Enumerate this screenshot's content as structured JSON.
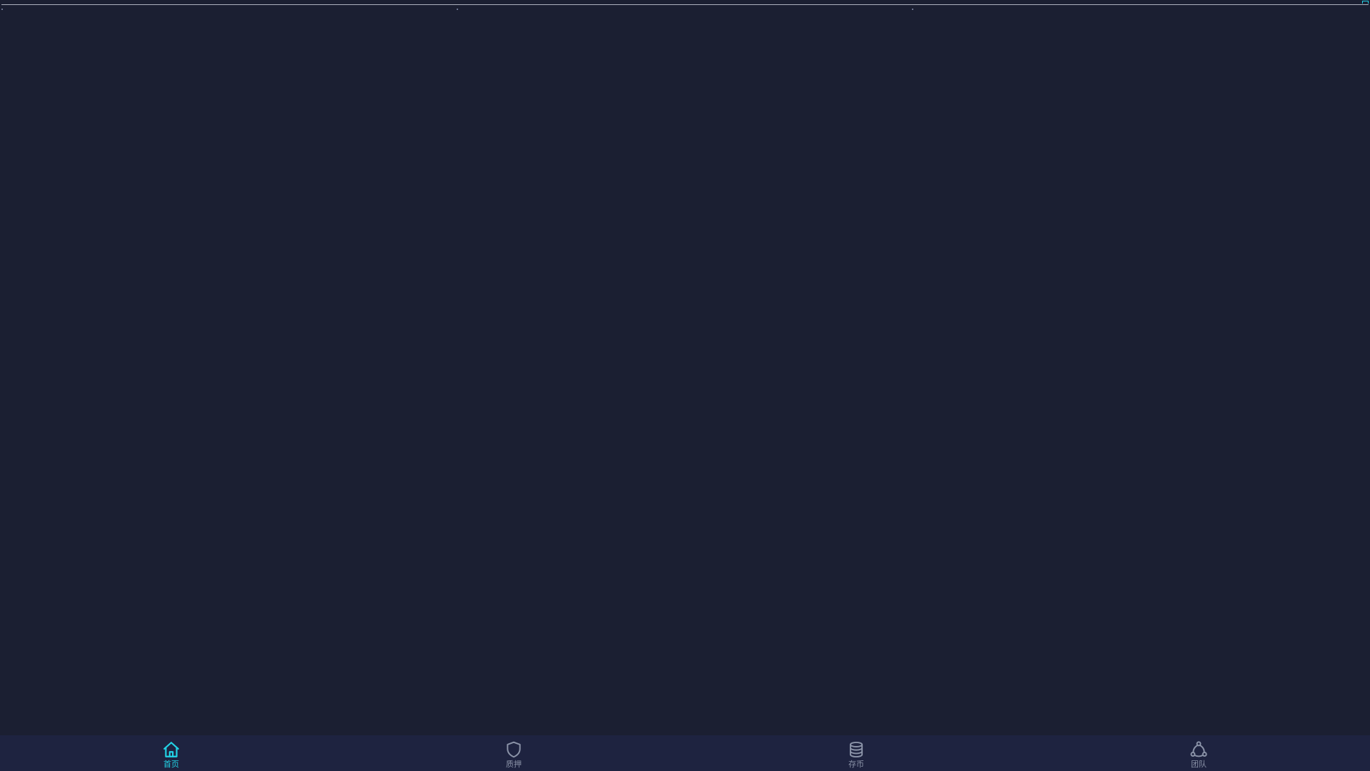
{
  "colors": {
    "background": "#1b1f32",
    "tabbar_background": "#1e2340",
    "accent": "#22d3e6",
    "inactive": "#8b93a8"
  },
  "tabbar": {
    "active_index": 0,
    "items": [
      {
        "label": "首页",
        "icon": "home-icon"
      },
      {
        "label": "质押",
        "icon": "shield-icon"
      },
      {
        "label": "存币",
        "icon": "coin-stack-icon"
      },
      {
        "label": "团队",
        "icon": "team-icon"
      }
    ]
  }
}
